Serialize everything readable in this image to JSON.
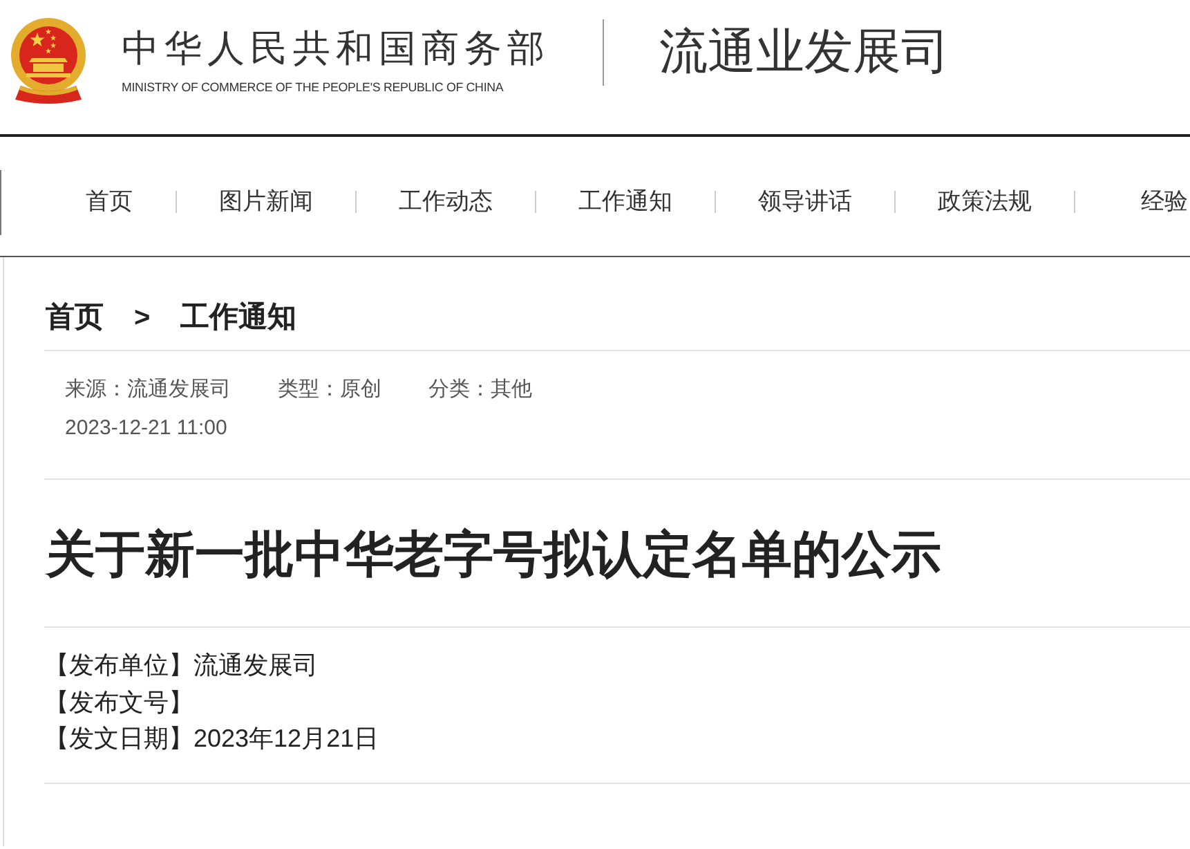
{
  "header": {
    "ministry_name": "中华人民共和国商务部",
    "ministry_name_en": "MINISTRY OF COMMERCE OF THE PEOPLE'S REPUBLIC OF CHINA",
    "department": "流通业发展司"
  },
  "nav": {
    "items": [
      "首页",
      "图片新闻",
      "工作动态",
      "工作通知",
      "领导讲话",
      "政策法规",
      "经验"
    ]
  },
  "breadcrumb": {
    "items": [
      "首页",
      "工作通知"
    ],
    "separator": ">"
  },
  "article": {
    "meta": [
      "来源：流通发展司",
      "类型：原创",
      "分类：其他"
    ],
    "date": "2023-12-21 11:00",
    "title": "关于新一批中华老字号拟认定名单的公示",
    "info": [
      "【发布单位】流通发展司",
      "【发布文号】",
      "【发文日期】2023年12月21日"
    ]
  }
}
